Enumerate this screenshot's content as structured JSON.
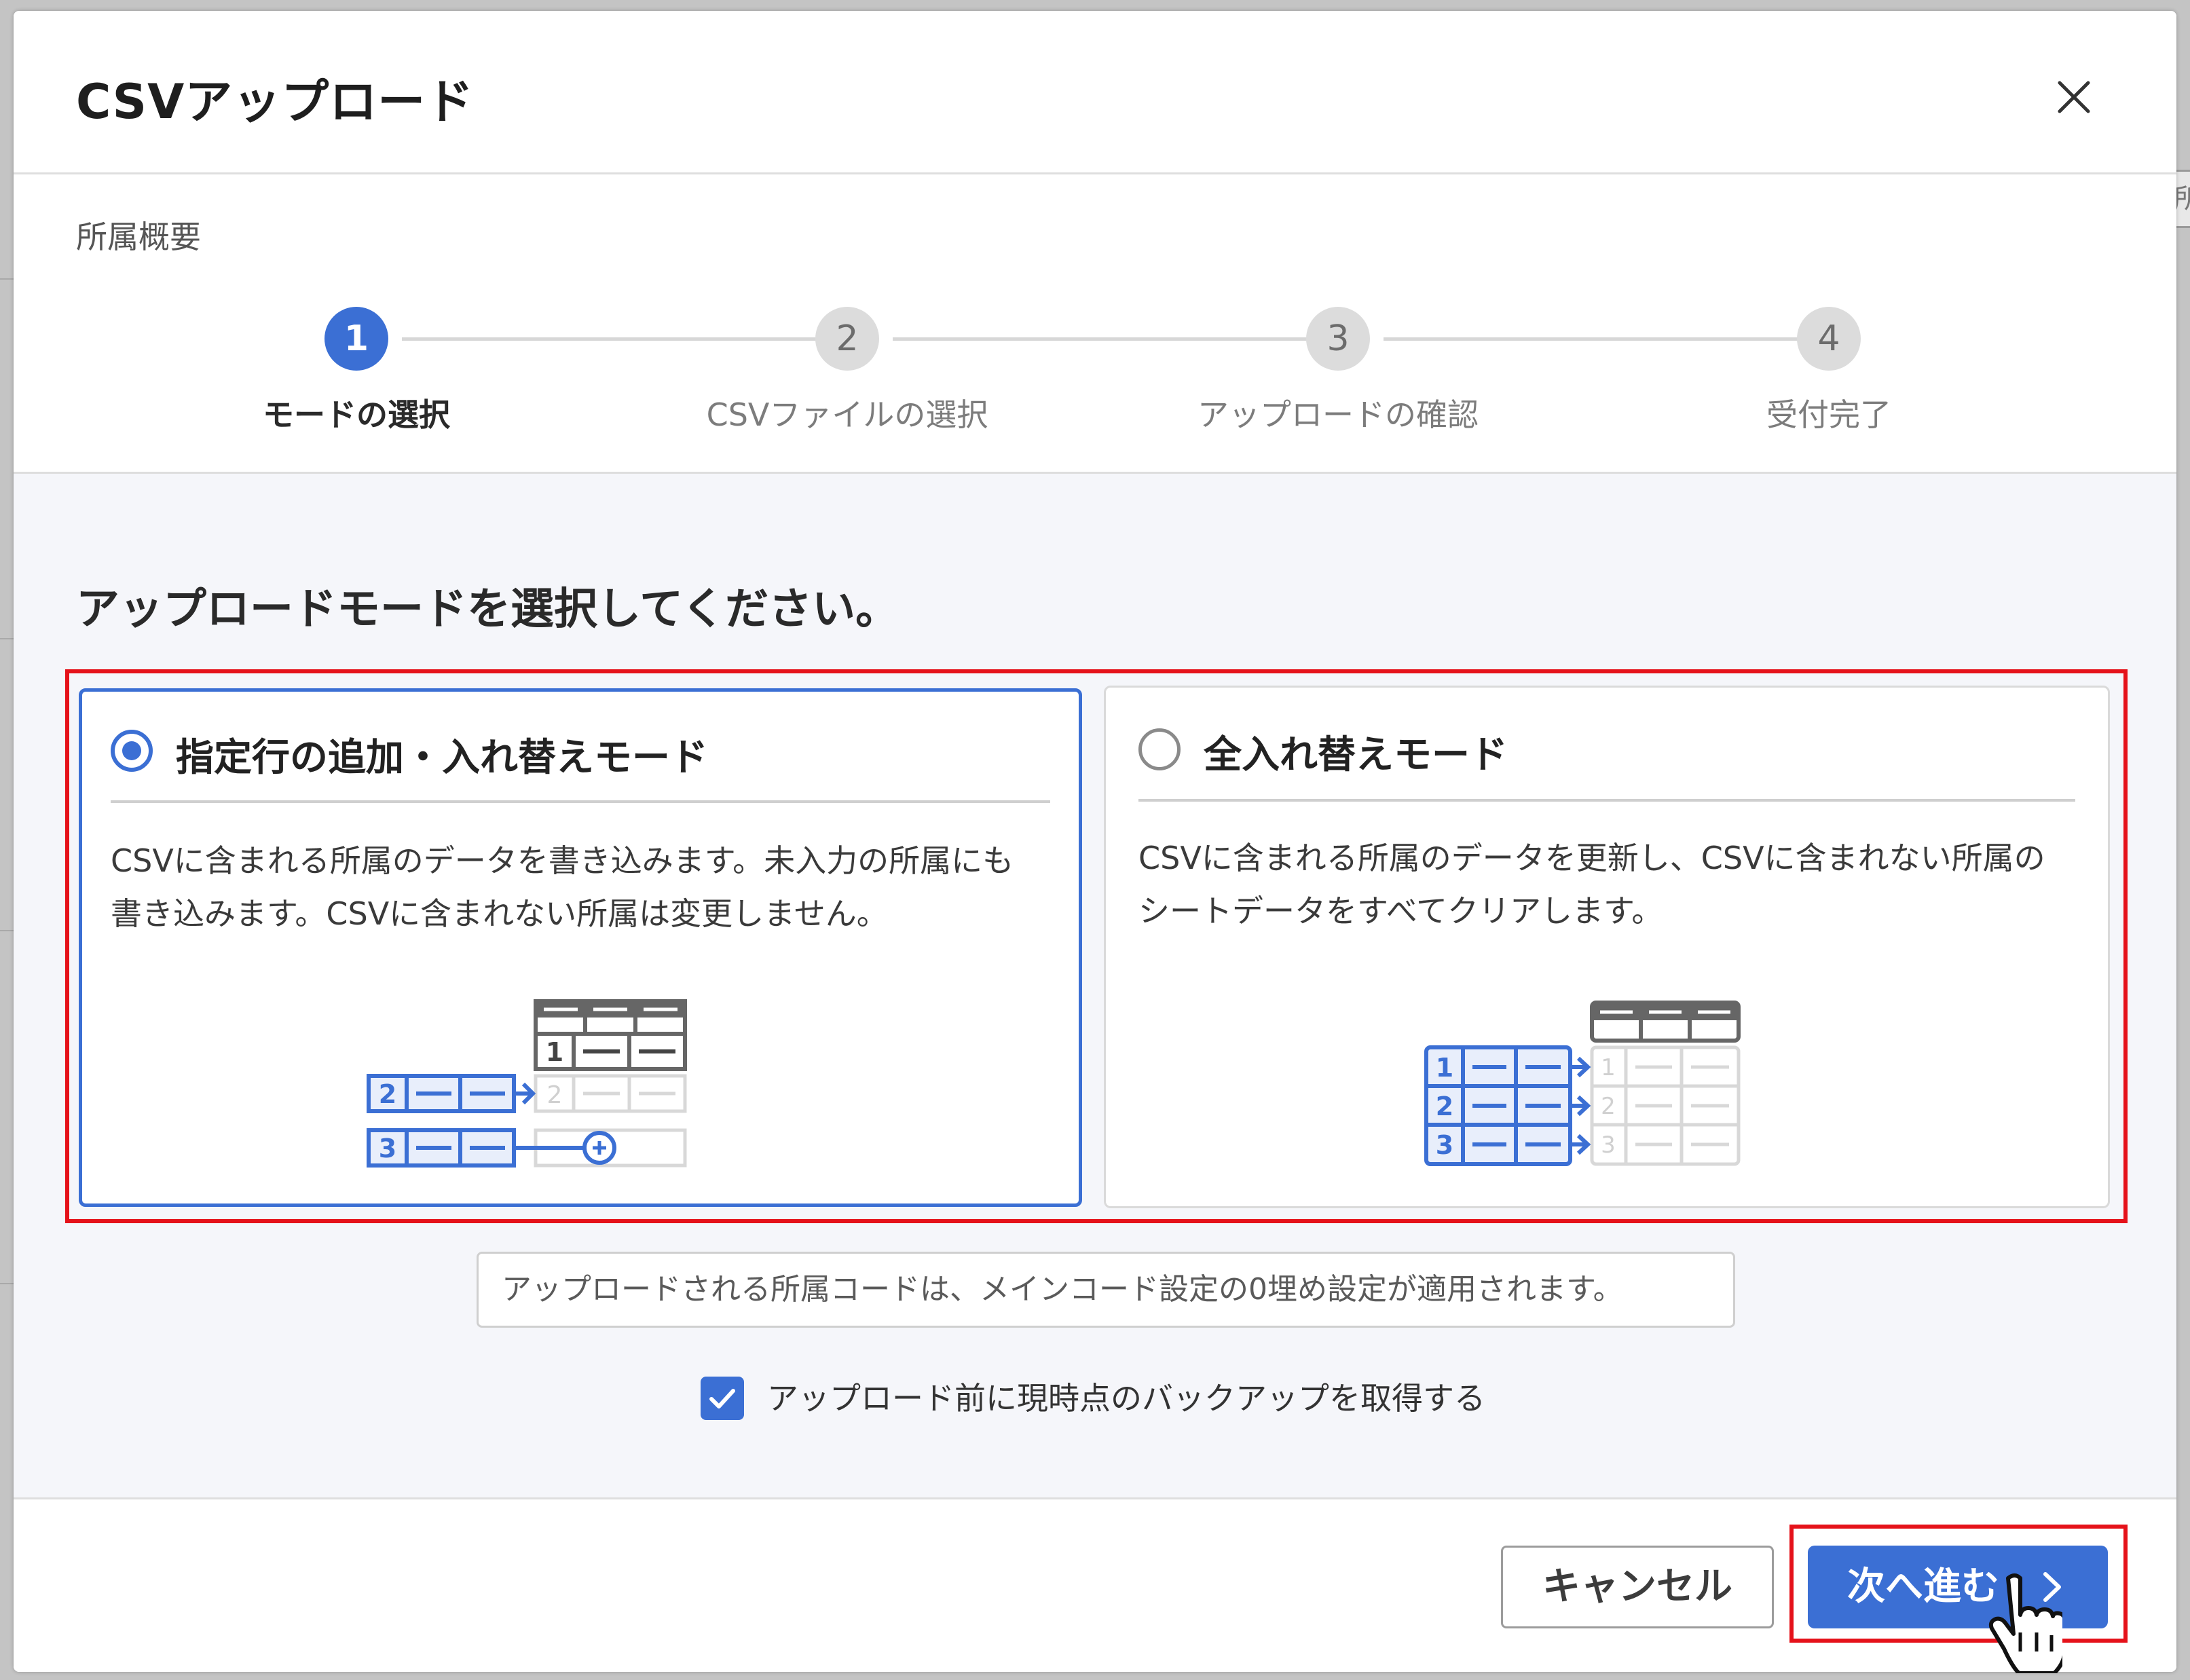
{
  "background": {
    "tab_char": "所"
  },
  "modal": {
    "title": "CSVアップロード",
    "close_icon": "close-icon"
  },
  "steps": {
    "section_label": "所属概要",
    "items": [
      {
        "number": "1",
        "label": "モードの選択",
        "state": "active"
      },
      {
        "number": "2",
        "label": "CSVファイルの選択",
        "state": "idle"
      },
      {
        "number": "3",
        "label": "アップロードの確認",
        "state": "idle"
      },
      {
        "number": "4",
        "label": "受付完了",
        "state": "idle"
      }
    ]
  },
  "body": {
    "instruction": "アップロードモードを選択してください。",
    "modes": [
      {
        "title": "指定行の追加・入れ替えモード",
        "description_line1": "CSVに含まれる所属のデータを書き込みます。未入力の所属にも",
        "description_line2": "書き込みます。CSVに含まれない所属は変更しません。",
        "selected": true,
        "illustration": "add-replace-rows-illustration",
        "illus_left_rows": [
          "2",
          "3"
        ],
        "illus_right_rows": [
          "1",
          "2"
        ]
      },
      {
        "title": "全入れ替えモード",
        "description_line1": "CSVに含まれる所属のデータを更新し、CSVに含まれない所属の",
        "description_line2": "シートデータをすべてクリアします。",
        "selected": false,
        "illustration": "replace-all-illustration",
        "illus_left_rows": [
          "1",
          "2",
          "3"
        ],
        "illus_right_rows": [
          "1",
          "2",
          "3"
        ]
      }
    ],
    "info_text": "アップロードされる所属コードは、メインコード設定の0埋め設定が適用されます。",
    "backup_checkbox": {
      "checked": true,
      "label": "アップロード前に現時点のバックアップを取得する"
    }
  },
  "footer": {
    "cancel_label": "キャンセル",
    "next_label": "次へ進む",
    "next_icon": "chevron-right-icon"
  },
  "colors": {
    "accent": "#3b6fd4",
    "highlight": "#e5121a",
    "muted": "#dcdcdc"
  }
}
